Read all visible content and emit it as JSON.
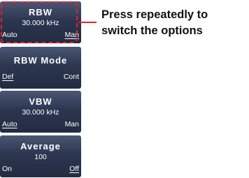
{
  "softkeys": [
    {
      "title": "RBW",
      "value": "30.000 kHz",
      "left_option": "Auto",
      "right_option": "Man",
      "selected": "right"
    },
    {
      "title": "RBW Mode",
      "value": "",
      "left_option": "Def",
      "right_option": "Cont",
      "selected": "left"
    },
    {
      "title": "VBW",
      "value": "30.000 kHz",
      "left_option": "Auto",
      "right_option": "Man",
      "selected": "left"
    },
    {
      "title": "Average",
      "value": "100",
      "left_option": "On",
      "right_option": "Off",
      "selected": "right"
    }
  ],
  "callout": {
    "line1": "Press repeatedly to",
    "line2": "switch the options"
  },
  "colors": {
    "highlight": "#e8212b",
    "softkey_top": "#4a5773",
    "softkey_bottom": "#222b40"
  }
}
